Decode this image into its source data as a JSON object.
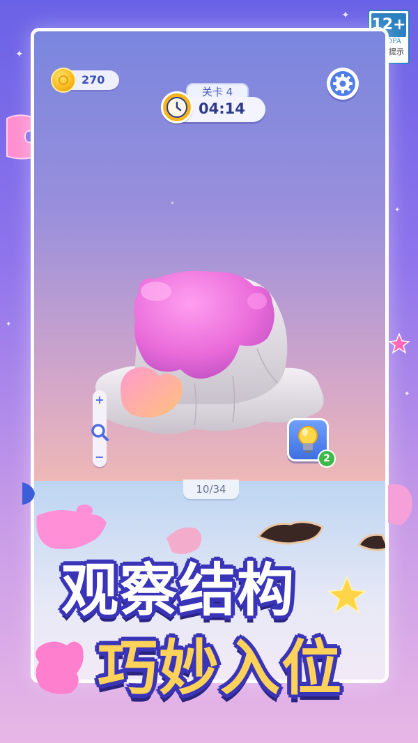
{
  "age_rating": {
    "number": "12+",
    "org": "CADPA",
    "note": "适龄提示"
  },
  "hud": {
    "coins": "270",
    "level": "关卡 4",
    "timer": "04:14"
  },
  "zoom": {
    "plus": "+",
    "minus": "−"
  },
  "hint": {
    "count": "2"
  },
  "progress": "10/34",
  "headline": {
    "line1": "观察结构",
    "line2": "巧妙入位"
  },
  "colors": {
    "accent": "#4f7ee8",
    "gold": "#f7b51b",
    "title_outline": "#3a35b8",
    "title_fill_2": "#ffd25a"
  }
}
